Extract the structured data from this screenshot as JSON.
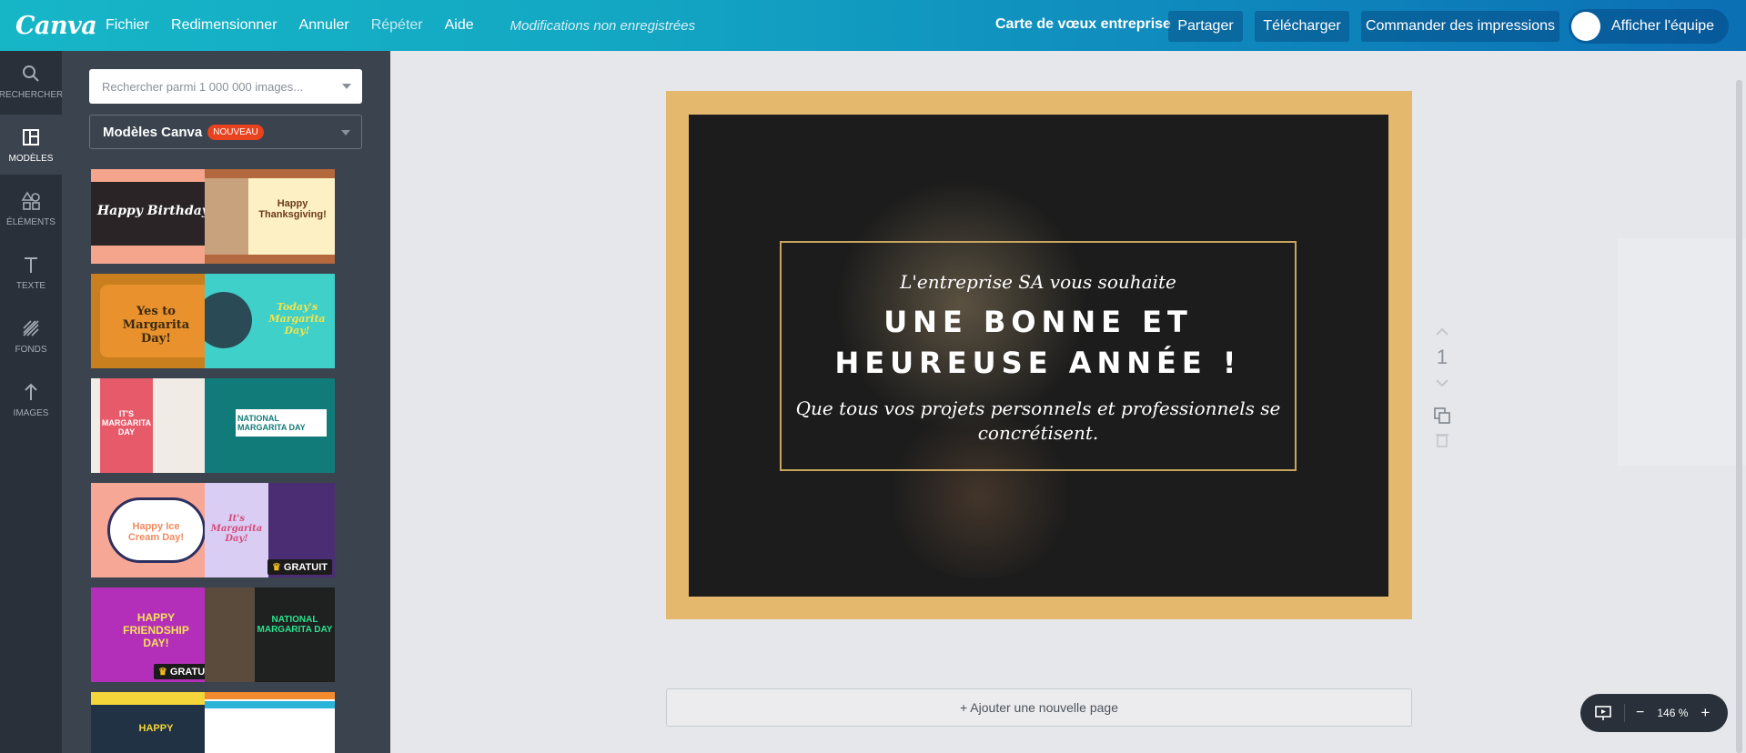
{
  "topbar": {
    "logo": "Canva",
    "menu": [
      "Fichier",
      "Redimensionner",
      "Annuler",
      "Répéter",
      "Aide"
    ],
    "unsaved": "Modifications non enregistrées",
    "doc_title": "Carte de vœux entreprise",
    "share": "Partager",
    "download": "Télécharger",
    "print": "Commander des impressions",
    "team": "Afficher l'équipe"
  },
  "rail": [
    {
      "label": "RECHERCHER",
      "icon": "search-icon"
    },
    {
      "label": "MODÈLES",
      "icon": "layout-icon"
    },
    {
      "label": "ÉLÉMENTS",
      "icon": "shapes-icon"
    },
    {
      "label": "TEXTE",
      "icon": "text-icon"
    },
    {
      "label": "FONDS",
      "icon": "background-icon"
    },
    {
      "label": "IMAGES",
      "icon": "upload-icon"
    }
  ],
  "panel": {
    "search_placeholder": "Rechercher parmi 1 000 000 images...",
    "selector": "Modèles Canva",
    "badge": "NOUVEAU",
    "gratuit": "GRATUIT",
    "templates": [
      {
        "text": "Happy Birthday!",
        "bg": "#f5a58c"
      },
      {
        "text": "Happy Thanksgiving!",
        "bg": "#fdf0c4"
      },
      {
        "text": "Yes to Margarita Day!",
        "bg": "#e8912d"
      },
      {
        "text": "Today's Margarita Day!",
        "bg": "#3fd0c9"
      },
      {
        "text": "IT'S MARGARITA DAY",
        "bg": "#e65a6a"
      },
      {
        "text": "NATIONAL MARGARITA DAY",
        "bg": "#117b7a"
      },
      {
        "text": "Happy Ice Cream Day!",
        "bg": "#f7a796"
      },
      {
        "text": "It's Margarita Day!",
        "bg": "#d9cdf3"
      },
      {
        "text": "HAPPY FRIENDSHIP DAY!",
        "bg": "#b42fb9"
      },
      {
        "text": "NATIONAL MARGARITA DAY",
        "bg": "#1e2120"
      },
      {
        "text": "HAPPY",
        "bg": "#213244"
      },
      {
        "text": "",
        "bg": "#ffffff"
      }
    ]
  },
  "design": {
    "line1": "L'entreprise SA vous souhaite",
    "line2a": "UNE BONNE ET",
    "line2b": "HEUREUSE ANNÉE !",
    "line3": "Que tous vos projets personnels et professionnels se concrétisent."
  },
  "page": {
    "number": "1"
  },
  "add_page": "+ Ajouter une nouvelle page",
  "zoom": "146 %"
}
